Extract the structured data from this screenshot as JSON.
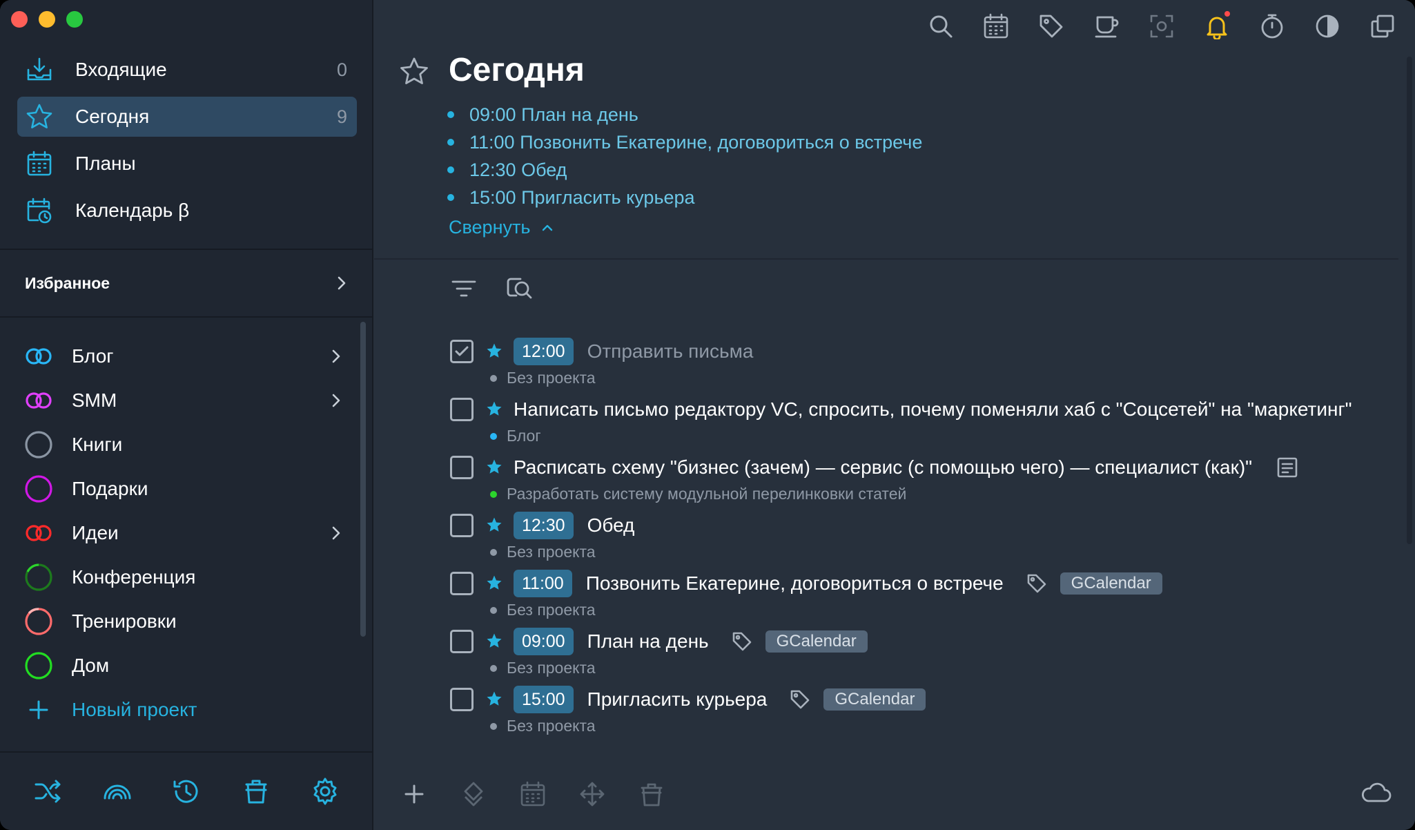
{
  "window": {
    "traffic_lights": [
      "close",
      "minimize",
      "zoom"
    ]
  },
  "sidebar": {
    "nav": [
      {
        "label": "Входящие",
        "count": "0",
        "icon": "inbox-icon"
      },
      {
        "label": "Сегодня",
        "count": "9",
        "icon": "star-icon",
        "active": true
      },
      {
        "label": "Планы",
        "count": "",
        "icon": "calendar-grid-icon"
      },
      {
        "label": "Календарь β",
        "count": "",
        "icon": "calendar-clock-icon"
      }
    ],
    "favorites_label": "Избранное",
    "projects": [
      {
        "label": "Блог",
        "color": "#29b6f6",
        "icon": "double-circle-icon",
        "has_children": true
      },
      {
        "label": "SMM",
        "color": "#e040fb",
        "icon": "double-circle-icon",
        "has_children": true
      },
      {
        "label": "Книги",
        "color": "#8a95a3",
        "icon": "circle-icon",
        "has_children": false
      },
      {
        "label": "Подарки",
        "color": "#d018e6",
        "icon": "circle-icon",
        "has_children": false
      },
      {
        "label": "Идеи",
        "color": "#ff2a2a",
        "icon": "double-circle-icon",
        "has_children": true
      },
      {
        "label": "Конференция",
        "color": "#2cd42c",
        "icon": "progress-circle-icon",
        "has_children": false
      },
      {
        "label": "Тренировки",
        "color": "#ff6b6b",
        "icon": "progress-circle-icon",
        "has_children": false
      },
      {
        "label": "Дом",
        "color": "#22dd22",
        "icon": "circle-icon",
        "has_children": false
      }
    ],
    "new_project_label": "Новый проект",
    "bottom_icons": [
      "shuffle-icon",
      "rainbow-icon",
      "history-icon",
      "trash-icon",
      "settings-icon"
    ]
  },
  "toolbar": {
    "icons": [
      "search-icon",
      "calendar-icon",
      "tag-icon",
      "coffee-icon",
      "focus-icon",
      "bell-icon",
      "timer-icon",
      "contrast-icon",
      "windows-icon"
    ]
  },
  "header": {
    "title": "Сегодня",
    "agenda": [
      "09:00 План на день",
      "11:00 Позвонить Екатерине, договориться о встрече",
      "12:30 Обед",
      "15:00 Пригласить курьера"
    ],
    "collapse_label": "Свернуть"
  },
  "tasks": [
    {
      "time": "12:00",
      "text": "Отправить письма",
      "project": "Без проекта",
      "project_color": "#8f99a6",
      "done": true,
      "tag": ""
    },
    {
      "time": "",
      "text": "Написать письмо редактору VC, спросить, почему поменяли хаб с \"Соцсетей\" на \"маркетинг\"",
      "project": "Блог",
      "project_color": "#29b6f6",
      "done": false,
      "tag": ""
    },
    {
      "time": "",
      "text": "Расписать схему \"бизнес (зачем) — сервис (с помощью чего) — специалист (как)\"",
      "project": "Разработать систему модульной перелинковки статей",
      "project_color": "#2cd42c",
      "done": false,
      "tag": "",
      "has_note": true
    },
    {
      "time": "12:30",
      "text": "Обед",
      "project": "Без проекта",
      "project_color": "#8f99a6",
      "done": false,
      "tag": ""
    },
    {
      "time": "11:00",
      "text": "Позвонить Екатерине, договориться о встрече",
      "project": "Без проекта",
      "project_color": "#8f99a6",
      "done": false,
      "tag": "GCalendar"
    },
    {
      "time": "09:00",
      "text": "План на день",
      "project": "Без проекта",
      "project_color": "#8f99a6",
      "done": false,
      "tag": "GCalendar"
    },
    {
      "time": "15:00",
      "text": "Пригласить курьера",
      "project": "Без проекта",
      "project_color": "#8f99a6",
      "done": false,
      "tag": "GCalendar"
    }
  ],
  "colors": {
    "accent": "#27b3e0",
    "active_bg": "#2f4a63",
    "time_badge": "#2f6f93",
    "tag_bg": "#546679",
    "bell": "#f7c21b"
  }
}
